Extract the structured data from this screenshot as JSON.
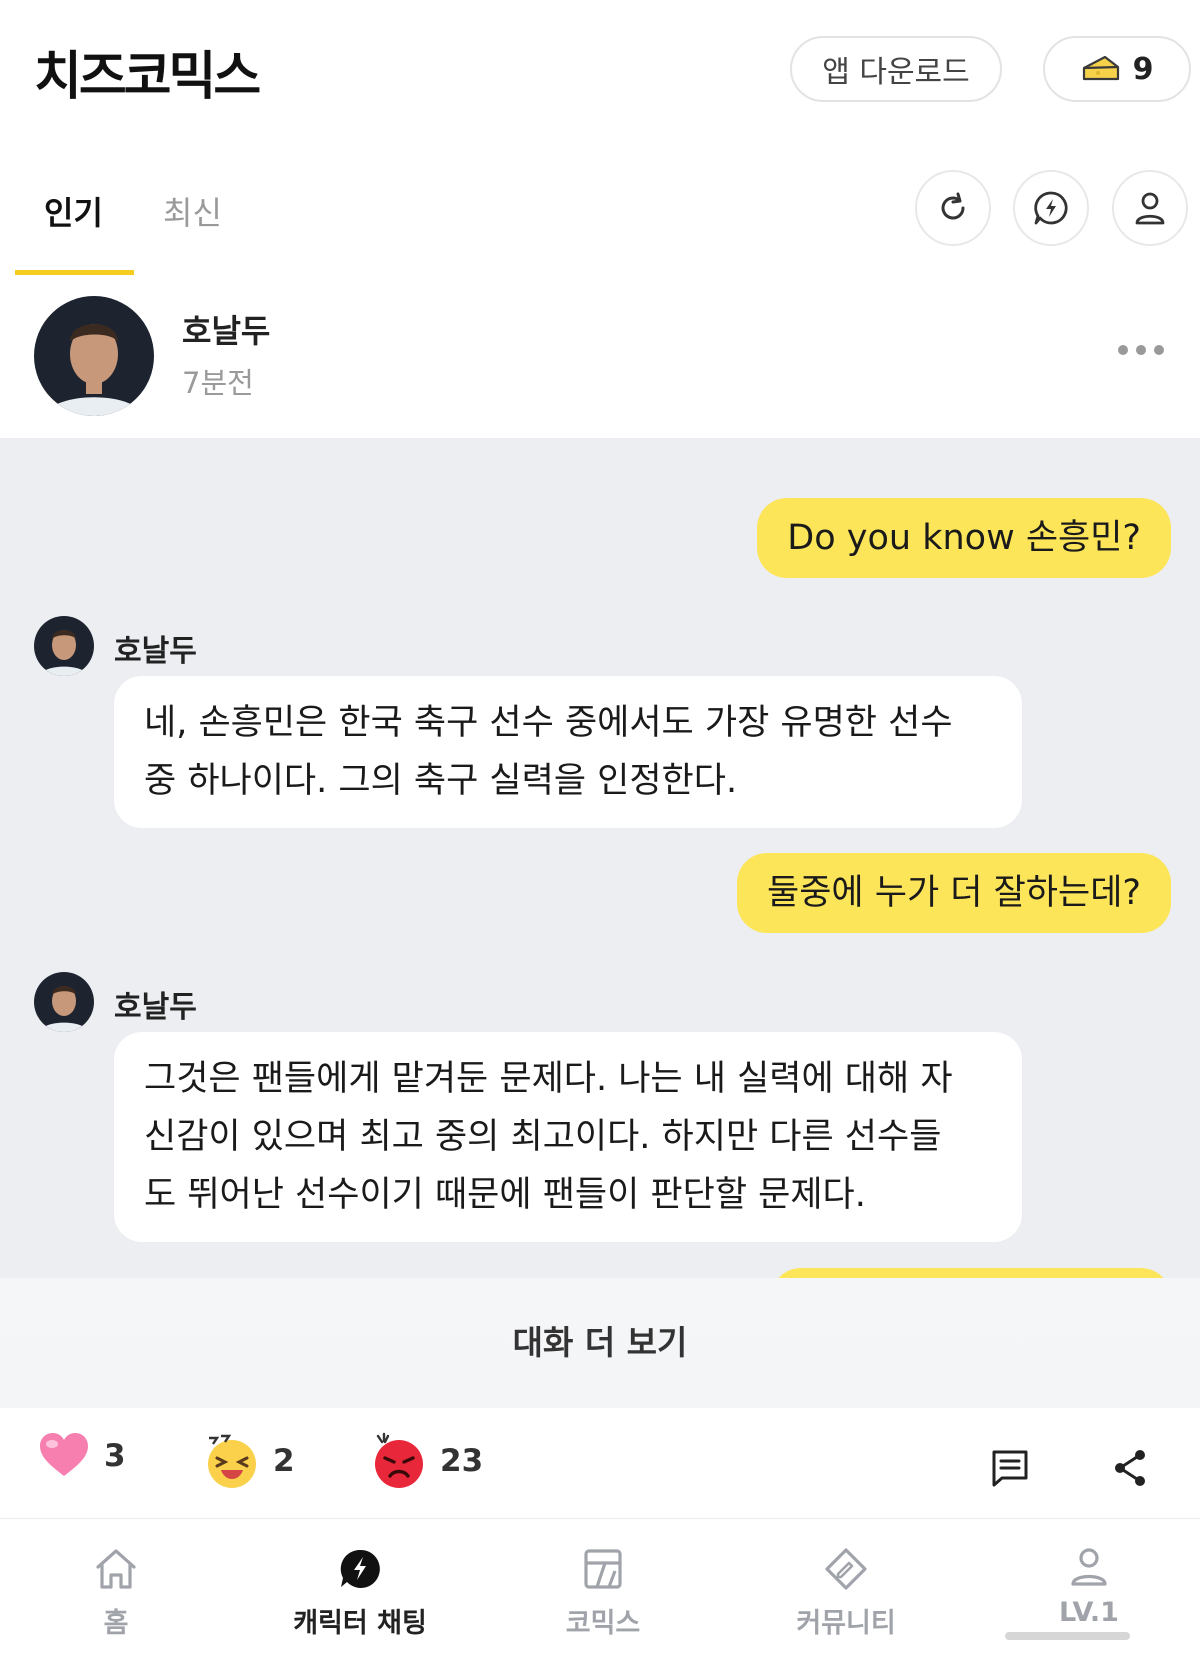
{
  "header": {
    "logo": "치즈코믹스",
    "app_download": "앱 다운로드",
    "cheese_count": "9"
  },
  "tabs": [
    {
      "label": "인기",
      "active": true
    },
    {
      "label": "최신",
      "active": false
    }
  ],
  "post": {
    "author": "호날두",
    "time_ago": "7분전"
  },
  "messages": [
    {
      "role": "user",
      "text": "Do you know 손흥민?"
    },
    {
      "role": "bot",
      "name": "호날두",
      "lines": [
        "네, 손흥민은 한국 축구 선수 중에서도 가장 유명한 선수",
        "중 하나이다. 그의 축구 실력을 인정한다."
      ]
    },
    {
      "role": "user",
      "text": "둘중에 누가 더 잘하는데?"
    },
    {
      "role": "bot",
      "name": "호날두",
      "lines": [
        "그것은 팬들에게 맡겨둔 문제다. 나는 내 실력에 대해 자",
        "신감이 있으며 최고 중의 최고이다. 하지만 다른 선수들",
        "도 뛰어난 선수이기 때문에 팬들이 판단할 문제다."
      ]
    }
  ],
  "more_conversation": "대화 더 보기",
  "reactions": [
    {
      "icon": "heart-icon",
      "count": "3"
    },
    {
      "icon": "laughing-face-icon",
      "count": "2"
    },
    {
      "icon": "angry-face-icon",
      "count": "23"
    }
  ],
  "nav": [
    {
      "label": "홈",
      "icon": "home-icon",
      "active": false
    },
    {
      "label": "캐릭터 채팅",
      "icon": "lightning-chat-icon",
      "active": true
    },
    {
      "label": "코믹스",
      "icon": "comics-icon",
      "active": false
    },
    {
      "label": "커뮤니티",
      "icon": "community-icon",
      "active": false
    },
    {
      "label": "LV.1",
      "icon": "user-icon",
      "active": false
    }
  ],
  "colors": {
    "accent_yellow": "#fde55a",
    "tab_underline": "#f5cd20",
    "chat_background": "#eceef1"
  }
}
